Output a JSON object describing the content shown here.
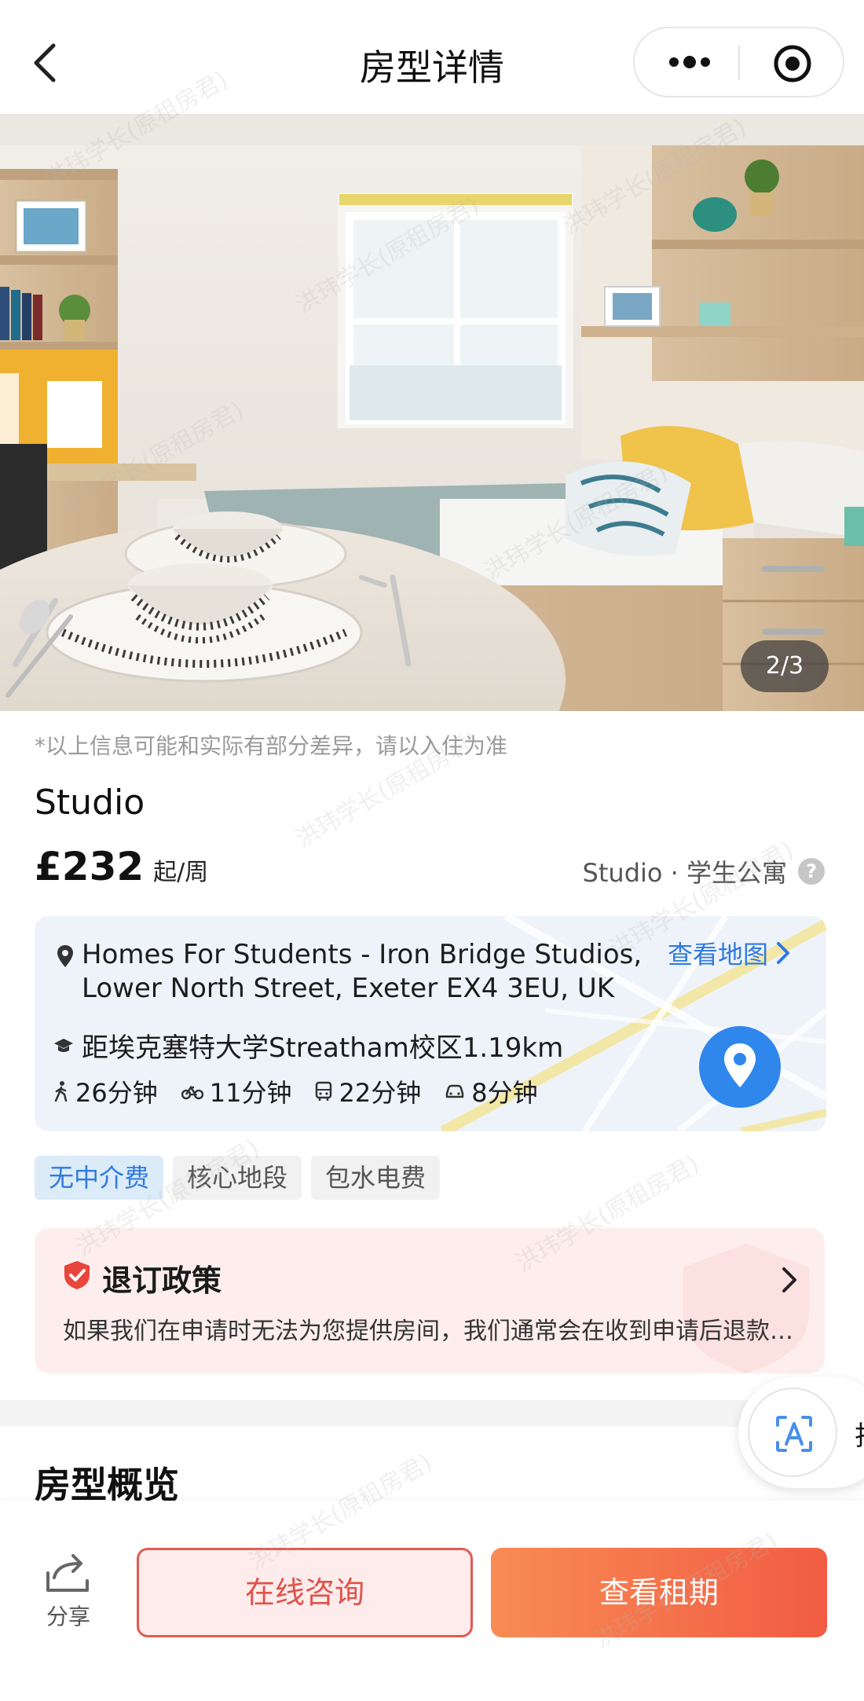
{
  "header": {
    "title": "房型详情"
  },
  "photo": {
    "counter": "2/3"
  },
  "disclaimer": "*以上信息可能和实际有部分差异，请以入住为准",
  "room": {
    "name": "Studio",
    "price": "£232",
    "price_unit": "起/周",
    "type": "Studio · 学生公寓"
  },
  "location": {
    "address": "Homes For Students - Iron Bridge Studios, Lower North Street, Exeter EX4 3EU, UK",
    "view_map": "查看地图",
    "university": "距埃克塞特大学Streatham校区1.19km",
    "travel": [
      {
        "icon": "walk-icon",
        "label": "26分钟"
      },
      {
        "icon": "bike-icon",
        "label": "11分钟"
      },
      {
        "icon": "bus-icon",
        "label": "22分钟"
      },
      {
        "icon": "car-icon",
        "label": "8分钟"
      }
    ]
  },
  "tags": [
    "无中介费",
    "核心地段",
    "包水电费"
  ],
  "policy": {
    "title": "退订政策",
    "description": "如果我们在申请时无法为您提供房间，我们通常会在收到申请后退款，并保留房间费用……"
  },
  "translate_fab": {
    "label": "扫"
  },
  "overview": {
    "title": "房型概览"
  },
  "bottom_bar": {
    "share": "分享",
    "consult": "在线咨询",
    "lease": "查看租期"
  },
  "watermark": "洪玮学长(原租房君)",
  "colors": {
    "accent_blue": "#2f7ae0",
    "accent_red": "#e0524a",
    "lease_gradient_start": "#f88b54",
    "lease_gradient_end": "#f25c43"
  }
}
